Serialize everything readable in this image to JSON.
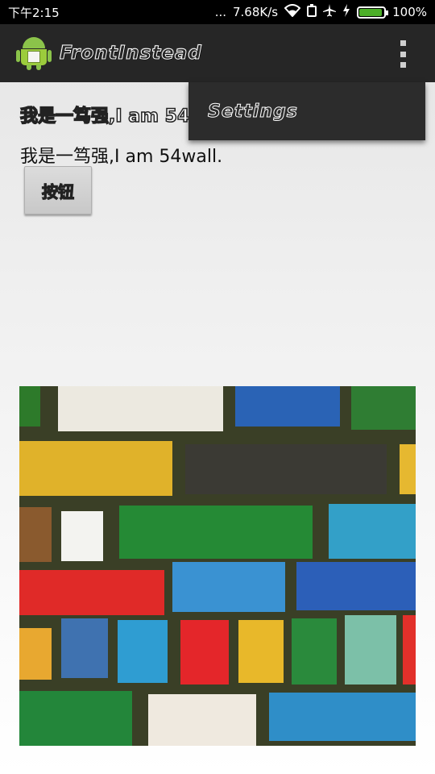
{
  "status_bar": {
    "time": "下午2:15",
    "dots": "...",
    "network_speed": "7.68K/s",
    "battery_percent": "100%"
  },
  "action_bar": {
    "title": "FrontInstead"
  },
  "overflow_menu": {
    "items": [
      {
        "label": "Settings"
      }
    ]
  },
  "content": {
    "styled_text": "我是一笃强,I am 54wall.",
    "plain_text": "我是一笃强,I am 54wall.",
    "button_label": "按钮"
  },
  "colors": {
    "status_bar_bg": "#000000",
    "action_bar_bg": "#262626",
    "popup_bg": "#2c2c2c",
    "battery_green": "#4caf28"
  }
}
